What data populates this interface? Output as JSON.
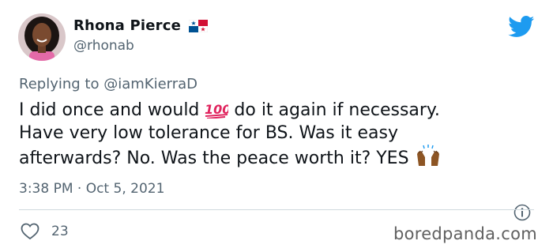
{
  "author": {
    "name": "Rhona Pierce",
    "handle": "@rhonab",
    "flag_icon": "panama-flag-icon"
  },
  "reply": {
    "prefix": "Replying to ",
    "mention": "@iamKierraD"
  },
  "tweet": {
    "line1_before": "I did once and would ",
    "line1_after": " do it again if necessary.",
    "line2": "Have very low tolerance for BS. Was it easy",
    "line3_before": "afterwards? No. Was the peace worth it? YES ",
    "emoji1": "hundred-points-emoji",
    "emoji2": "raising-hands-emoji"
  },
  "meta": {
    "timestamp": "3:38 PM · Oct 5, 2021"
  },
  "engagement": {
    "likes": "23"
  },
  "watermark": "boredpanda.com",
  "colors": {
    "twitter_blue": "#1d9bf0",
    "secondary_text": "#536471",
    "divider": "#cfd9de"
  }
}
